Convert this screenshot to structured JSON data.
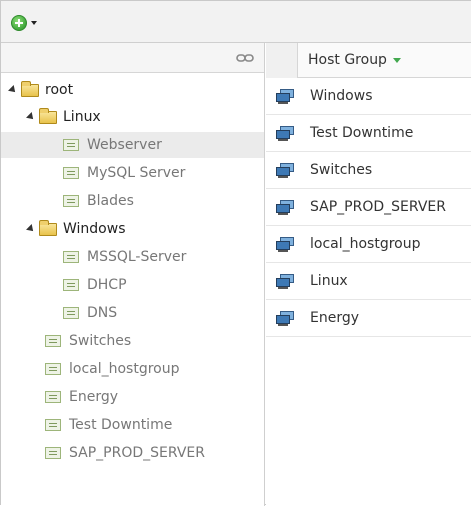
{
  "toolbar": {
    "add_icon": "add-circle-icon"
  },
  "tree": {
    "nodes": [
      {
        "label": "root",
        "type": "folder"
      },
      {
        "label": "Linux",
        "type": "folder"
      },
      {
        "label": "Webserver",
        "type": "node"
      },
      {
        "label": "MySQL Server",
        "type": "node"
      },
      {
        "label": "Blades",
        "type": "node"
      },
      {
        "label": "Windows",
        "type": "folder"
      },
      {
        "label": "MSSQL-Server",
        "type": "node"
      },
      {
        "label": "DHCP",
        "type": "node"
      },
      {
        "label": "DNS",
        "type": "node"
      },
      {
        "label": "Switches",
        "type": "node"
      },
      {
        "label": "local_hostgroup",
        "type": "node"
      },
      {
        "label": "Energy",
        "type": "node"
      },
      {
        "label": "Test Downtime",
        "type": "node"
      },
      {
        "label": "SAP_PROD_SERVER",
        "type": "node"
      }
    ]
  },
  "list": {
    "column_label": "Host Group",
    "rows": [
      {
        "label": "Windows"
      },
      {
        "label": "Test Downtime"
      },
      {
        "label": "Switches"
      },
      {
        "label": "SAP_PROD_SERVER"
      },
      {
        "label": "local_hostgroup"
      },
      {
        "label": "Linux"
      },
      {
        "label": "Energy"
      }
    ]
  }
}
